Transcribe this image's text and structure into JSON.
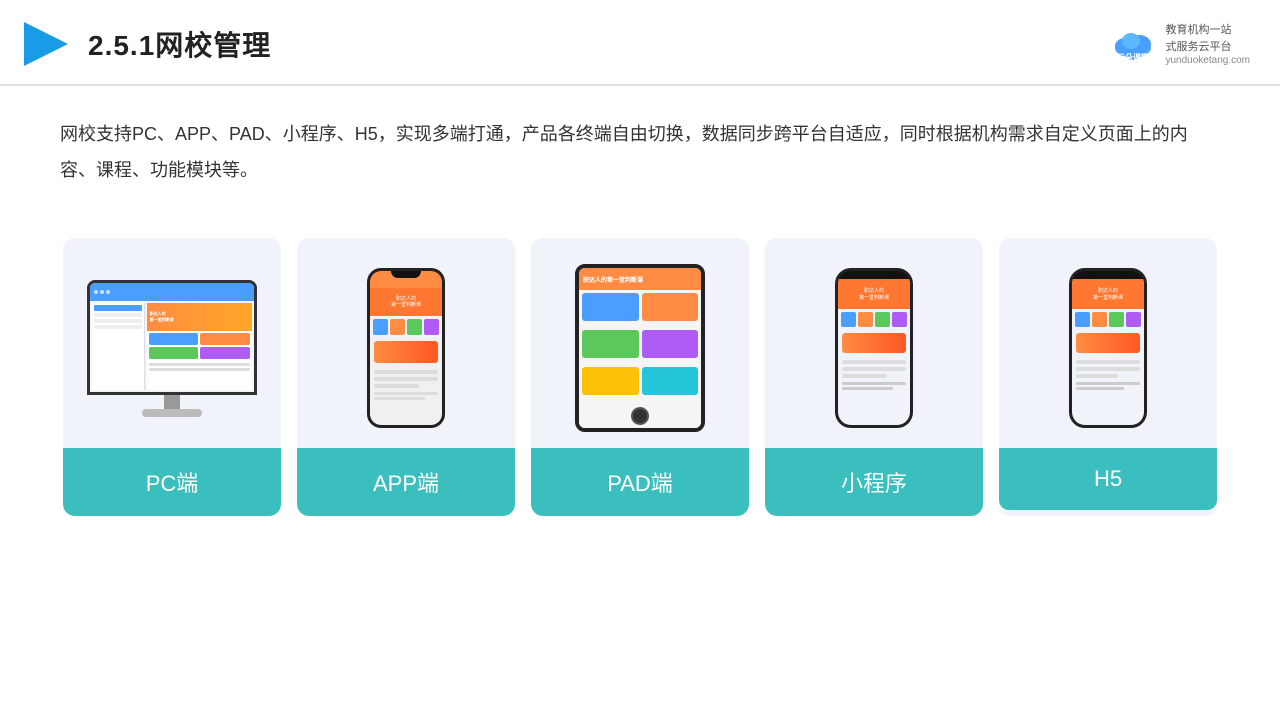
{
  "header": {
    "title": "2.5.1网校管理",
    "logo": {
      "brand": "云朵课堂",
      "domain": "yunduoketang.com",
      "slogan": "教育机构一站\n式服务云平台"
    }
  },
  "description": "网校支持PC、APP、PAD、小程序、H5，实现多端打通，产品各终端自由切换，数据同步跨平台自适应，同时根据机构需求自定义页面上的内容、课程、功能模块等。",
  "cards": [
    {
      "id": "pc",
      "label": "PC端"
    },
    {
      "id": "app",
      "label": "APP端"
    },
    {
      "id": "pad",
      "label": "PAD端"
    },
    {
      "id": "mini",
      "label": "小程序"
    },
    {
      "id": "h5",
      "label": "H5"
    }
  ],
  "colors": {
    "accent": "#3bbfbe",
    "title_color": "#222",
    "text_color": "#333",
    "card_bg": "#eef2f9"
  }
}
